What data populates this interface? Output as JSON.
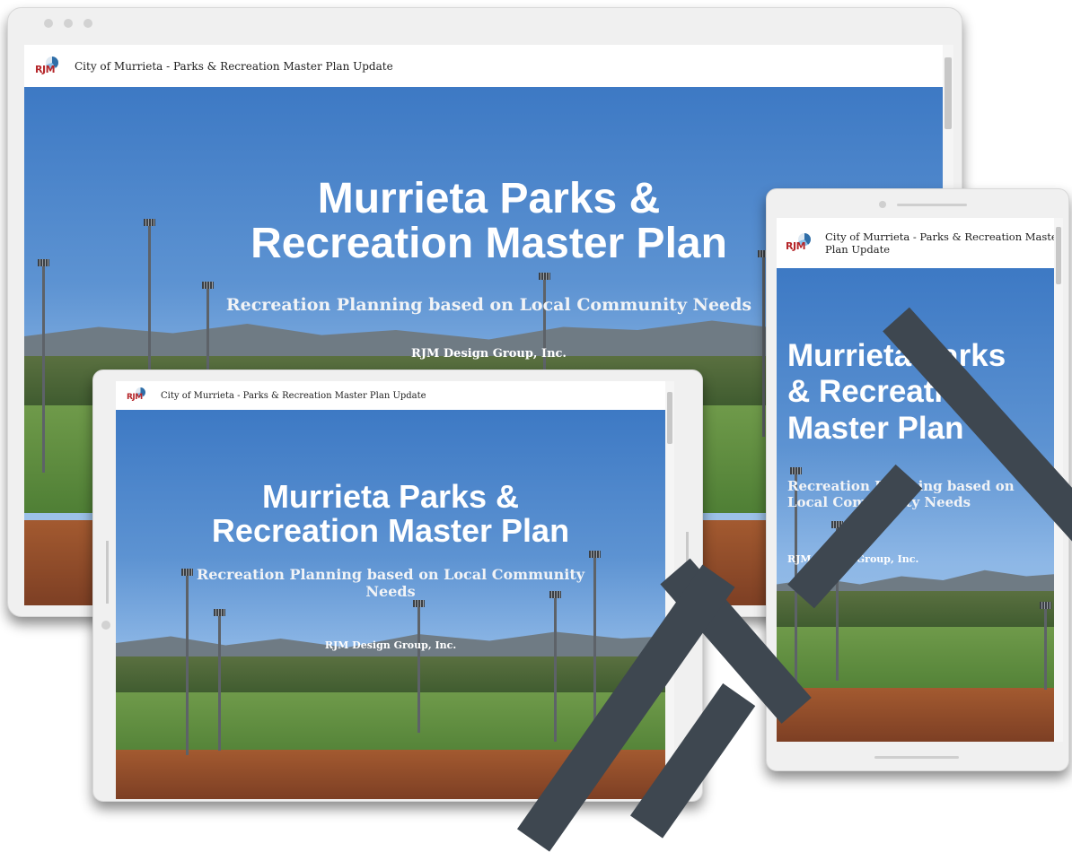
{
  "site": {
    "logo_text": "RJM",
    "title": "City of Murrieta - Parks & Recreation Master Plan Update"
  },
  "hero": {
    "heading": "Murrieta Parks & Recreation Master Plan",
    "subheading": "Recreation Planning based on Local Community Needs",
    "company": "RJM Design Group, Inc."
  },
  "mobile": {
    "title_line1": "City of Murrieta - Parks & Recreation Master",
    "title_line2": "Plan Update",
    "heading_line1": "Murrieta Parks",
    "heading_line2": "& Recreation",
    "heading_line3": "Master Plan",
    "sub_line1": "Recreation Planning based on",
    "sub_line2": "Local Community Needs"
  },
  "tablet": {
    "heading_line1": "Murrieta Parks &",
    "heading_line2": "Recreation Master Plan",
    "sub_line1": "Recreation Planning based on Local Community",
    "sub_line2": "Needs"
  },
  "colors": {
    "logo_red": "#b5262a",
    "sky_blue": "#3d79c4",
    "watermark": "#3e4750"
  }
}
